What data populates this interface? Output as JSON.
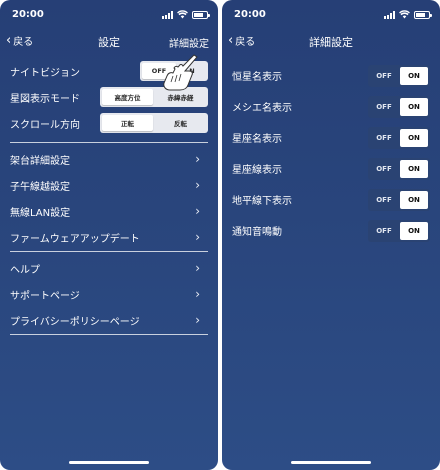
{
  "left": {
    "status": {
      "time": "20:00"
    },
    "nav": {
      "back": "戻る",
      "title": "設定",
      "right": "詳細設定"
    },
    "night_vision": {
      "label": "ナイトビジョン",
      "off": "OFF",
      "on": "N"
    },
    "star_display": {
      "label": "星図表示モード",
      "opt1": "高度方位",
      "opt2": "赤緯赤経"
    },
    "scroll": {
      "label": "スクロール方向",
      "opt1": "正転",
      "opt2": "反転"
    },
    "menu1": [
      "架台詳細設定",
      "子午線越設定",
      "無線LAN設定",
      "ファームウェアアップデート"
    ],
    "menu2": [
      "ヘルプ",
      "サポートページ",
      "プライバシーポリシーページ"
    ]
  },
  "right": {
    "status": {
      "time": "20:00"
    },
    "nav": {
      "back": "戻る",
      "title": "詳細設定"
    },
    "toggles": [
      {
        "label": "恒星名表示",
        "off": "OFF",
        "on": "ON"
      },
      {
        "label": "メシエ名表示",
        "off": "OFF",
        "on": "ON"
      },
      {
        "label": "星座名表示",
        "off": "OFF",
        "on": "ON"
      },
      {
        "label": "星座線表示",
        "off": "OFF",
        "on": "ON"
      },
      {
        "label": "地平線下表示",
        "off": "OFF",
        "on": "ON"
      },
      {
        "label": "通知音鳴動",
        "off": "OFF",
        "on": "ON"
      }
    ]
  }
}
